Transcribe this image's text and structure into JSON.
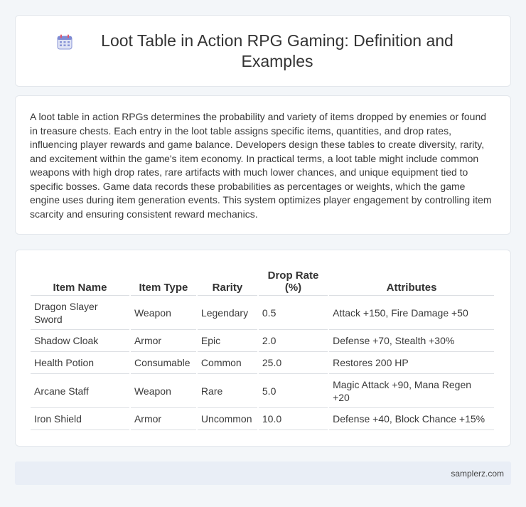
{
  "header": {
    "title": "Loot Table in Action RPG Gaming: Definition and Examples",
    "icon": "calendar-icon"
  },
  "description": "A loot table in action RPGs determines the probability and variety of items dropped by enemies or found in treasure chests. Each entry in the loot table assigns specific items, quantities, and drop rates, influencing player rewards and game balance. Developers design these tables to create diversity, rarity, and excitement within the game's item economy. In practical terms, a loot table might include common weapons with high drop rates, rare artifacts with much lower chances, and unique equipment tied to specific bosses. Game data records these probabilities as percentages or weights, which the game engine uses during item generation events. This system optimizes player engagement by controlling item scarcity and ensuring consistent reward mechanics.",
  "table": {
    "headers": [
      "Item Name",
      "Item Type",
      "Rarity",
      "Drop Rate (%)",
      "Attributes"
    ],
    "rows": [
      [
        "Dragon Slayer Sword",
        "Weapon",
        "Legendary",
        "0.5",
        "Attack +150, Fire Damage +50"
      ],
      [
        "Shadow Cloak",
        "Armor",
        "Epic",
        "2.0",
        "Defense +70, Stealth +30%"
      ],
      [
        "Health Potion",
        "Consumable",
        "Common",
        "25.0",
        "Restores 200 HP"
      ],
      [
        "Arcane Staff",
        "Weapon",
        "Rare",
        "5.0",
        "Magic Attack +90, Mana Regen +20"
      ],
      [
        "Iron Shield",
        "Armor",
        "Uncommon",
        "10.0",
        "Defense +40, Block Chance +15%"
      ]
    ]
  },
  "footer": {
    "site": "samplerz.com"
  }
}
